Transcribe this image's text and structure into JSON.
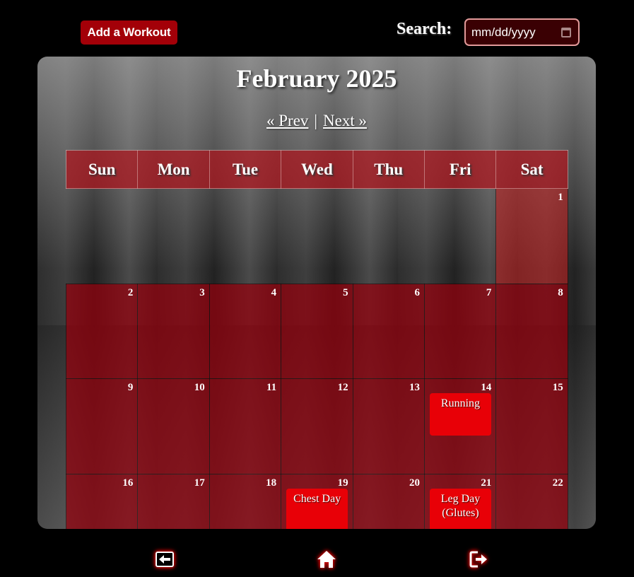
{
  "header": {
    "add_workout_label": "Add a Workout",
    "search_label": "Search:",
    "date_placeholder": "mm/dd/yyyy"
  },
  "calendar": {
    "title": "February 2025",
    "prev_label": "« Prev",
    "separator": "|",
    "next_label": "Next »",
    "weekdays": [
      "Sun",
      "Mon",
      "Tue",
      "Wed",
      "Thu",
      "Fri",
      "Sat"
    ],
    "weeks": [
      [
        null,
        null,
        null,
        null,
        null,
        null,
        {
          "day": "1"
        }
      ],
      [
        {
          "day": "2"
        },
        {
          "day": "3"
        },
        {
          "day": "4"
        },
        {
          "day": "5"
        },
        {
          "day": "6"
        },
        {
          "day": "7"
        },
        {
          "day": "8"
        }
      ],
      [
        {
          "day": "9"
        },
        {
          "day": "10"
        },
        {
          "day": "11"
        },
        {
          "day": "12"
        },
        {
          "day": "13"
        },
        {
          "day": "14",
          "event": "Running"
        },
        {
          "day": "15"
        }
      ],
      [
        {
          "day": "16"
        },
        {
          "day": "17"
        },
        {
          "day": "18"
        },
        {
          "day": "19",
          "event": "Chest Day"
        },
        {
          "day": "20"
        },
        {
          "day": "21",
          "event": "Leg Day (Glutes)"
        },
        {
          "day": "22"
        }
      ]
    ]
  },
  "footer": {
    "icons": [
      "back-arrow-icon",
      "home-icon",
      "logout-icon"
    ]
  },
  "colors": {
    "accent": "#a30008",
    "event": "#e80007",
    "cell": "#96000c"
  }
}
